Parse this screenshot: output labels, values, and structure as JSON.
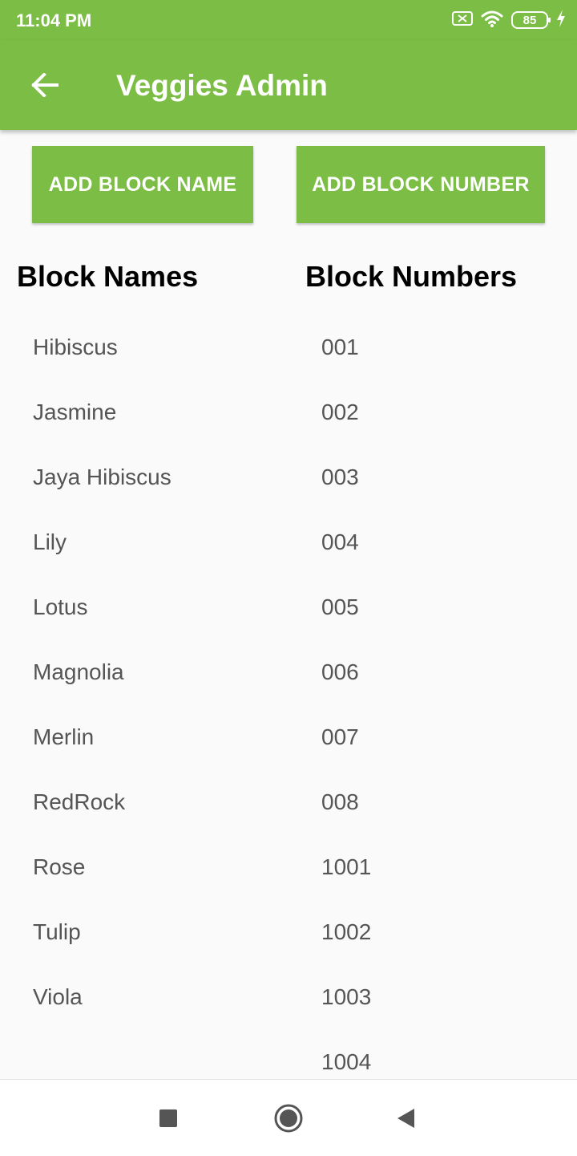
{
  "status_bar": {
    "time": "11:04 PM",
    "battery": "85",
    "icons": [
      "sim-off-icon",
      "wifi-icon",
      "battery-icon",
      "charging-icon"
    ]
  },
  "app_bar": {
    "title": "Veggies Admin",
    "back_icon": "arrow-back-icon"
  },
  "buttons": {
    "add_block_name": "ADD BLOCK NAME",
    "add_block_number": "ADD BLOCK NUMBER"
  },
  "block_names": {
    "heading": "Block Names",
    "items": [
      "Hibiscus",
      "Jasmine",
      "Jaya Hibiscus",
      "Lily",
      "Lotus",
      "Magnolia",
      "Merlin",
      "RedRock",
      "Rose",
      "Tulip",
      "Viola"
    ]
  },
  "block_numbers": {
    "heading": "Block Numbers",
    "items": [
      "001",
      "002",
      "003",
      "004",
      "005",
      "006",
      "007",
      "008",
      "1001",
      "1002",
      "1003",
      "1004"
    ]
  },
  "nav_bar": {
    "icons": [
      "recents-icon",
      "home-icon",
      "back-icon"
    ]
  },
  "colors": {
    "primary": "#7cbd45",
    "background": "#fafafa",
    "list_text": "#555555"
  }
}
